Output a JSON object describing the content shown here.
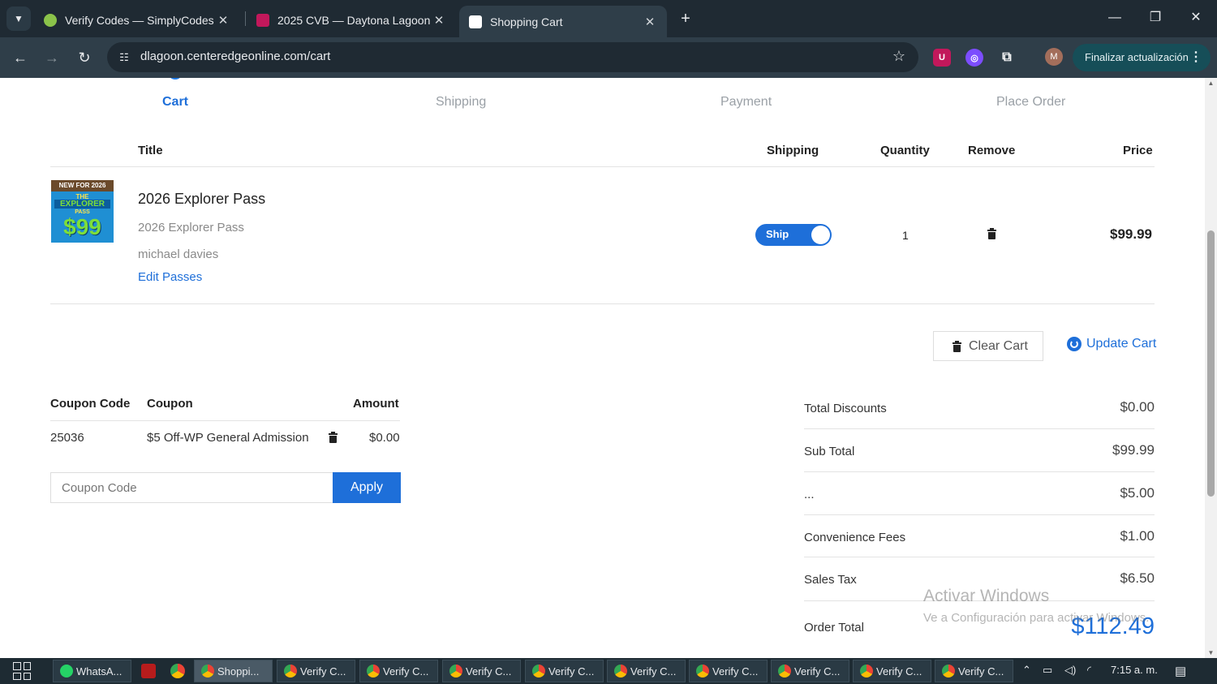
{
  "browser": {
    "tabs": [
      {
        "title": "Verify Codes — SimplyCodes",
        "active": false
      },
      {
        "title": "2025 CVB — Daytona Lagoon",
        "active": false
      },
      {
        "title": "Shopping Cart",
        "active": true
      }
    ],
    "url": "dlagoon.centeredgeonline.com/cart",
    "update_button": "Finalizar actualización",
    "profile_initial": "M"
  },
  "steps": [
    "Cart",
    "Shipping",
    "Payment",
    "Place Order"
  ],
  "cart": {
    "headers": {
      "title": "Title",
      "shipping": "Shipping",
      "quantity": "Quantity",
      "remove": "Remove",
      "price": "Price"
    },
    "item": {
      "title": "2026 Explorer Pass",
      "subtitle": "2026 Explorer Pass",
      "holder": "michael davies",
      "edit_link": "Edit Passes",
      "ship_toggle_label": "Ship",
      "ship_enabled": true,
      "quantity": "1",
      "price": "$99.99",
      "image_text": {
        "band": "NEW FOR 2026",
        "line1": "THE",
        "line2": "EXPLORER",
        "line3": "PASS",
        "price": "$99"
      }
    },
    "clear_button": "Clear Cart",
    "update_button": "Update Cart"
  },
  "coupons": {
    "headers": {
      "code": "Coupon Code",
      "coupon": "Coupon",
      "amount": "Amount"
    },
    "rows": [
      {
        "code": "25036",
        "coupon": "$5 Off-WP General Admission",
        "amount": "$0.00"
      }
    ],
    "input_placeholder": "Coupon Code",
    "apply_button": "Apply"
  },
  "summary": {
    "rows": [
      {
        "label": "Total Discounts",
        "value": "$0.00"
      },
      {
        "label": "Sub Total",
        "value": "$99.99"
      },
      {
        "label": "...",
        "value": "$5.00"
      },
      {
        "label": "Convenience Fees",
        "value": "$1.00"
      },
      {
        "label": "Sales Tax",
        "value": "$6.50"
      }
    ],
    "total_label": "Order Total",
    "total_value": "$112.49"
  },
  "watermark": {
    "line1": "Activar Windows",
    "line2": "Ve a Configuración para activar Windows."
  },
  "taskbar": {
    "items": [
      "WhatsA...",
      "Shoppi...",
      "Verify C...",
      "Verify C...",
      "Verify C...",
      "Verify C...",
      "Verify C...",
      "Verify C...",
      "Verify C...",
      "Verify C...",
      "Verify C..."
    ],
    "time": "7:15 a. m."
  },
  "colors": {
    "accent": "#1e6fd9",
    "chrome_bg": "#1f2a33",
    "toolbar_bg": "#2f3e49"
  }
}
